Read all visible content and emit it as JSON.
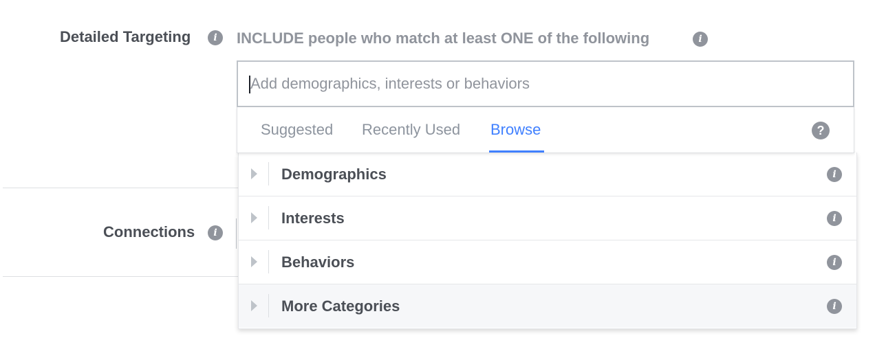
{
  "detailed_targeting": {
    "label": "Detailed Targeting",
    "include_heading": "INCLUDE people who match at least ONE of the following",
    "search": {
      "placeholder": "Add demographics, interests or behaviors",
      "value": ""
    },
    "tabs": [
      {
        "label": "Suggested",
        "active": false
      },
      {
        "label": "Recently Used",
        "active": false
      },
      {
        "label": "Browse",
        "active": true
      }
    ],
    "help_glyph": "?",
    "categories": [
      {
        "label": "Demographics"
      },
      {
        "label": "Interests"
      },
      {
        "label": "Behaviors"
      },
      {
        "label": "More Categories"
      }
    ]
  },
  "connections": {
    "label": "Connections"
  },
  "icons": {
    "info": "info-icon",
    "help": "help-icon",
    "expand": "caret-right-icon"
  },
  "colors": {
    "accent": "#4080ff",
    "label": "#4b4f56",
    "muted": "#90949c",
    "border": "#dddfe2"
  }
}
